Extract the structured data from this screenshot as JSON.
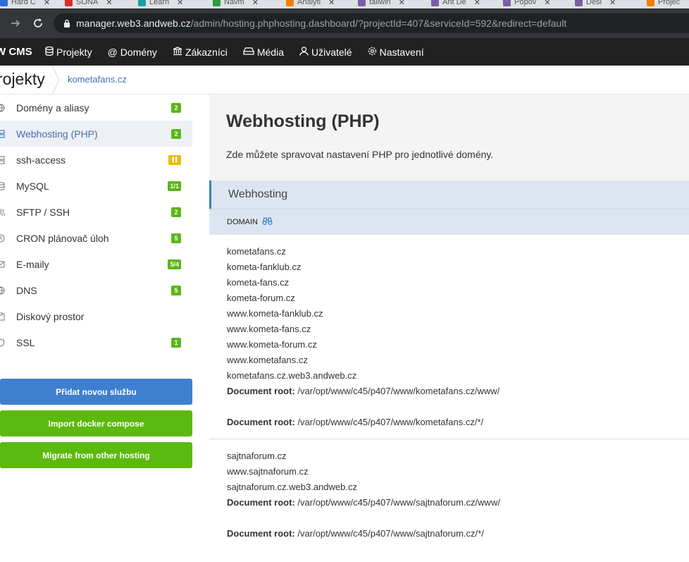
{
  "browser": {
    "tabs": [
      "Hard C",
      "SONA",
      "Learn",
      "Navm",
      "Analyti",
      "tailwin",
      "Ant De",
      "Popov",
      "Desi",
      "Projec"
    ],
    "url_host": "manager.web3.andweb.cz",
    "url_path": "/admin/hosting.phphosting.dashboard/?projectId=407&serviceId=592&redirect=default"
  },
  "appnav": {
    "brand": "W CMS",
    "items": [
      {
        "icon": "database-icon",
        "label": "Projekty"
      },
      {
        "icon": "at-icon",
        "label": "Domény"
      },
      {
        "icon": "bank-icon",
        "label": "Zákazníci"
      },
      {
        "icon": "drive-icon",
        "label": "Média"
      },
      {
        "icon": "user-icon",
        "label": "Uživatelé"
      },
      {
        "icon": "gear-icon",
        "label": "Nastavení"
      }
    ]
  },
  "breadcrumb": {
    "title": "rojekty",
    "link": "kometafans.cz"
  },
  "sidebar": {
    "items": [
      {
        "label": "Domény a aliasy",
        "badge": "2",
        "icon": "globe-icon"
      },
      {
        "label": "Webhosting (PHP)",
        "badge": "2",
        "icon": "server-icon",
        "active": true
      },
      {
        "label": "ssh-access",
        "badge": "",
        "icon": "server-icon",
        "badge_type": "pause"
      },
      {
        "label": "MySQL",
        "badge": "1/1",
        "icon": "database-icon"
      },
      {
        "label": "SFTP / SSH",
        "badge": "2",
        "icon": "users-icon"
      },
      {
        "label": "CRON plánovač úloh",
        "badge": "5",
        "icon": "clock-icon"
      },
      {
        "label": "E-maily",
        "badge": "5/4",
        "icon": "mail-icon"
      },
      {
        "label": "DNS",
        "badge": "5",
        "icon": "globe-icon"
      },
      {
        "label": "Diskový prostor",
        "badge": "",
        "icon": "save-icon"
      },
      {
        "label": "SSL",
        "badge": "1",
        "icon": "shield-icon"
      }
    ],
    "buttons": {
      "add": "Přidat novou službu",
      "docker": "Import docker compose",
      "migrate": "Migrate from other hosting"
    }
  },
  "main": {
    "title": "Webhosting (PHP)",
    "description": "Zde můžete spravovat nastavení PHP pro jednotlivé domény.",
    "section": "Webhosting",
    "column": "DOMAIN",
    "doc_root_label": "Document root:",
    "groups": [
      {
        "domains": [
          "kometafans.cz",
          "kometa-fanklub.cz",
          "kometa-fans.cz",
          "kometa-forum.cz",
          "www.kometa-fanklub.cz",
          "www.kometa-fans.cz",
          "www.kometa-forum.cz",
          "www.kometafans.cz",
          "kometafans.cz.web3.andweb.cz"
        ],
        "roots": [
          "/var/opt/www/c45/p407/www/kometafans.cz/www/",
          "/var/opt/www/c45/p407/www/kometafans.cz/*/"
        ]
      },
      {
        "domains": [
          "sajtnaforum.cz",
          "www.sajtnaforum.cz",
          "sajtnaforum.cz.web3.andweb.cz"
        ],
        "roots": [
          "/var/opt/www/c45/p407/www/sajtnaforum.cz/www/",
          "/var/opt/www/c45/p407/www/sajtnaforum.cz/*/"
        ]
      }
    ]
  },
  "colors": {
    "nav_bg": "#212121",
    "accent_blue": "#3e7fd0",
    "badge_green": "#5cb618",
    "badge_yellow": "#f0b90b",
    "section_bg": "#dce6f2"
  }
}
